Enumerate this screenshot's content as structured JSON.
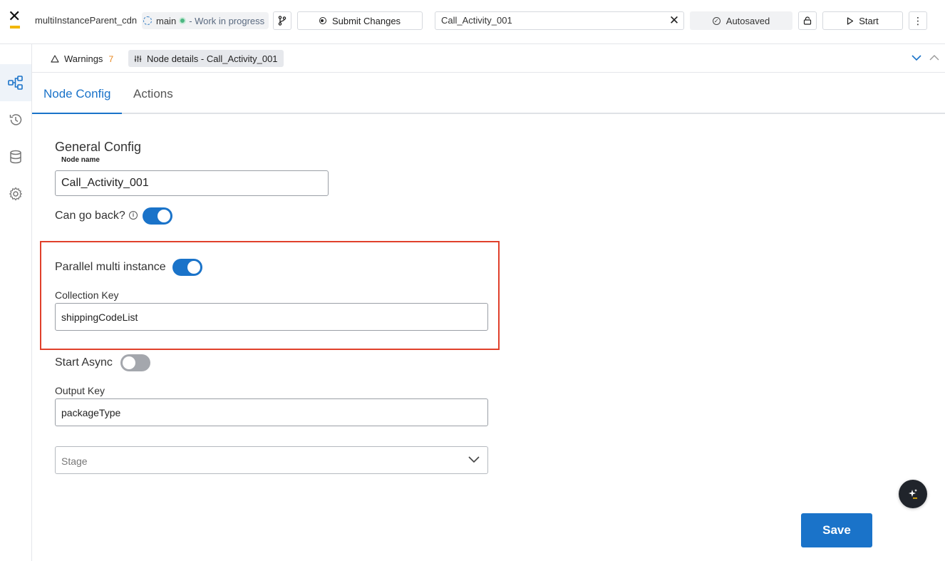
{
  "app": {
    "project_name": "multiInstanceParent_cdn",
    "branch_name": "main",
    "branch_status": "- Work in progress"
  },
  "toolbar": {
    "submit_label": "Submit Changes",
    "search_value": "Call_Activity_001",
    "autosaved_label": "Autosaved",
    "start_label": "Start",
    "more_label": "⋮"
  },
  "sidebar": {
    "items": [
      {
        "icon": "process-diagram-icon",
        "active": true
      },
      {
        "icon": "history-icon",
        "active": false
      },
      {
        "icon": "database-icon",
        "active": false
      },
      {
        "icon": "gear-icon",
        "active": false
      }
    ]
  },
  "panel": {
    "warnings_label": "Warnings",
    "warnings_count": "7",
    "node_details_label": "Node details - Call_Activity_001"
  },
  "tabs": [
    {
      "label": "Node Config",
      "active": true
    },
    {
      "label": "Actions",
      "active": false
    }
  ],
  "form": {
    "section_title": "General Config",
    "node_name_label": "Node name",
    "node_name_value": "Call_Activity_001",
    "can_go_back_label": "Can go back?",
    "can_go_back": true,
    "parallel_label": "Parallel multi instance",
    "parallel": true,
    "collection_key_label": "Collection Key",
    "collection_key_value": "shippingCodeList",
    "start_async_label": "Start Async",
    "start_async": false,
    "output_key_label": "Output Key",
    "output_key_value": "packageType",
    "stage_placeholder": "Stage"
  },
  "actions": {
    "save_label": "Save"
  },
  "colors": {
    "accent": "#1a73c9",
    "highlight_border": "#e0402b",
    "warning_count": "#e8841a",
    "logo_bar": "#f2b705"
  }
}
